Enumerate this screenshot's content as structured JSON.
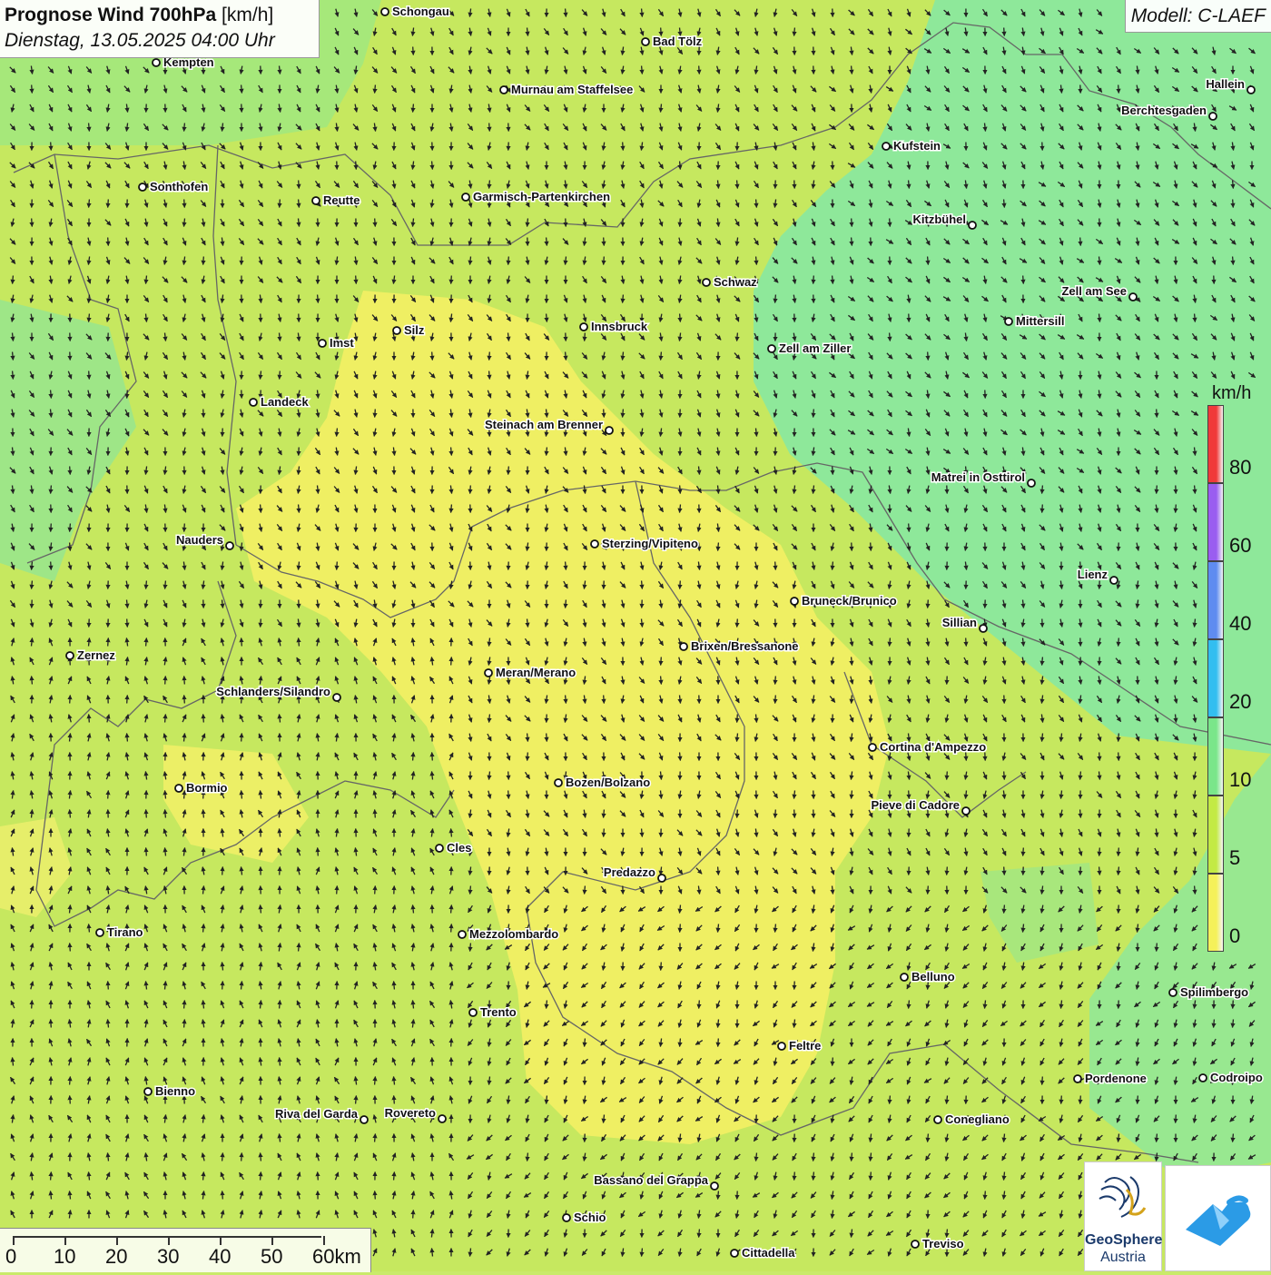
{
  "header": {
    "title_bold": "Prognose Wind 700hPa",
    "title_unit": "[km/h]",
    "subtitle": "Dienstag, 13.05.2025 04:00 Uhr",
    "model": "Modell: C-LAEF"
  },
  "legend": {
    "unit": "km/h",
    "labels": [
      "80",
      "60",
      "40",
      "20",
      "10",
      "5",
      "0"
    ],
    "colors": [
      "#f03a3a",
      "#9a5df0",
      "#5f8cf0",
      "#32bef0",
      "#7ae68a",
      "#c3ea44",
      "#f5f15a"
    ]
  },
  "scalebar": {
    "labels": [
      "0",
      "10",
      "20",
      "30",
      "40",
      "50",
      "60km"
    ]
  },
  "logo": {
    "name_line1": "GeoSphere",
    "name_line2": "Austria"
  },
  "cities": [
    {
      "name": "Schongau",
      "side": "r"
    },
    {
      "name": "Bad Tölz",
      "side": "r"
    },
    {
      "name": "Kempten",
      "side": "r"
    },
    {
      "name": "Murnau am Staffelsee",
      "side": "r"
    },
    {
      "name": "Hallein",
      "side": "l"
    },
    {
      "name": "Berchtesgaden",
      "side": "l"
    },
    {
      "name": "Kufstein",
      "side": "r"
    },
    {
      "name": "Sonthofen",
      "side": "r"
    },
    {
      "name": "Reutte",
      "side": "r"
    },
    {
      "name": "Garmisch-Partenkirchen",
      "side": "r"
    },
    {
      "name": "Kitzbühel",
      "side": "l"
    },
    {
      "name": "Schwaz",
      "side": "r"
    },
    {
      "name": "Zell am See",
      "side": "l"
    },
    {
      "name": "Silz",
      "side": "r"
    },
    {
      "name": "Innsbruck",
      "side": "r"
    },
    {
      "name": "Mittersill",
      "side": "r"
    },
    {
      "name": "Imst",
      "side": "r"
    },
    {
      "name": "Zell am Ziller",
      "side": "r"
    },
    {
      "name": "Landeck",
      "side": "r"
    },
    {
      "name": "Steinach am Brenner",
      "side": "l"
    },
    {
      "name": "Matrei in Osttirol",
      "side": "l"
    },
    {
      "name": "Nauders",
      "side": "l"
    },
    {
      "name": "Sterzing/Vipiteno",
      "side": "r"
    },
    {
      "name": "Lienz",
      "side": "l"
    },
    {
      "name": "Bruneck/Brunico",
      "side": "r"
    },
    {
      "name": "Sillian",
      "side": "l"
    },
    {
      "name": "Brixen/Bressanone",
      "side": "r"
    },
    {
      "name": "Zernez",
      "side": "r"
    },
    {
      "name": "Meran/Merano",
      "side": "r"
    },
    {
      "name": "Schlanders/Silandro",
      "side": "l"
    },
    {
      "name": "Cortina d'Ampezzo",
      "side": "r"
    },
    {
      "name": "Bozen/Bolzano",
      "side": "r"
    },
    {
      "name": "Bormio",
      "side": "r"
    },
    {
      "name": "Pieve di Cadore",
      "side": "l"
    },
    {
      "name": "Cles",
      "side": "r"
    },
    {
      "name": "Predazzo",
      "side": "l"
    },
    {
      "name": "Tirano",
      "side": "r"
    },
    {
      "name": "Mezzolombardo",
      "side": "r"
    },
    {
      "name": "Belluno",
      "side": "r"
    },
    {
      "name": "Spilimbergo",
      "side": "r"
    },
    {
      "name": "Trento",
      "side": "r"
    },
    {
      "name": "Feltre",
      "side": "r"
    },
    {
      "name": "Pordenone",
      "side": "r"
    },
    {
      "name": "Codroipo",
      "side": "r"
    },
    {
      "name": "Bienno",
      "side": "r"
    },
    {
      "name": "Riva del Garda",
      "side": "l"
    },
    {
      "name": "Rovereto",
      "side": "l"
    },
    {
      "name": "Conegliano",
      "side": "r"
    },
    {
      "name": "Bassano del Grappa",
      "side": "l"
    },
    {
      "name": "Schio",
      "side": "r"
    },
    {
      "name": "Treviso",
      "side": "r"
    },
    {
      "name": "Cittadella",
      "side": "r"
    }
  ]
}
